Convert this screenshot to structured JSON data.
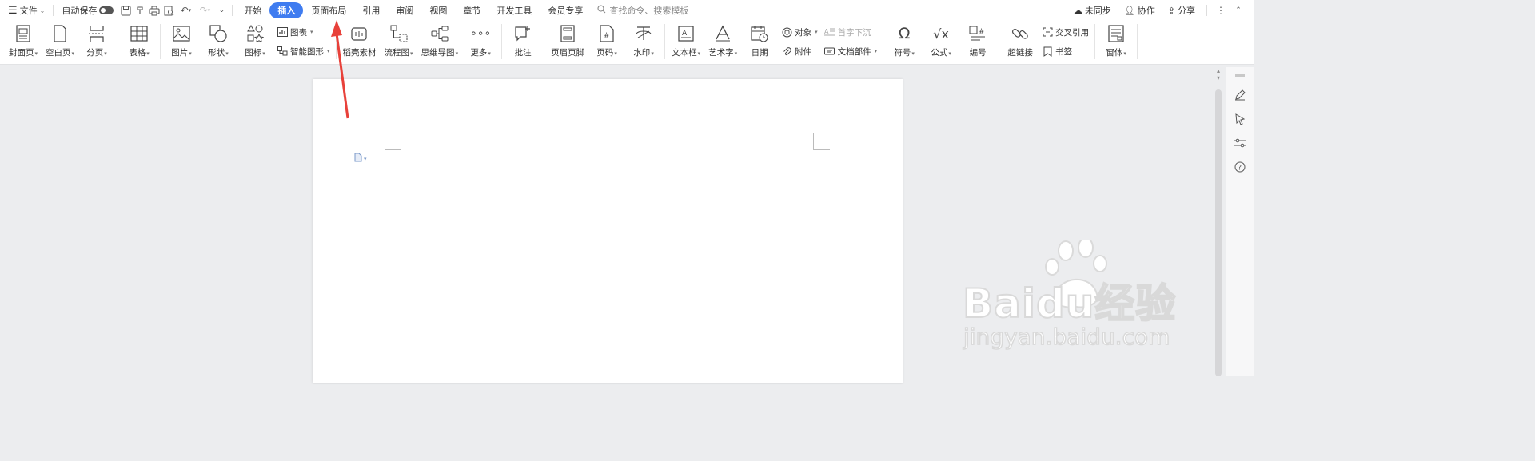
{
  "menubar": {
    "file_label": "文件",
    "autosave_label": "自动保存",
    "tabs": [
      {
        "label": "开始",
        "active": false
      },
      {
        "label": "插入",
        "active": true
      },
      {
        "label": "页面布局",
        "active": false
      },
      {
        "label": "引用",
        "active": false
      },
      {
        "label": "审阅",
        "active": false
      },
      {
        "label": "视图",
        "active": false
      },
      {
        "label": "章节",
        "active": false
      },
      {
        "label": "开发工具",
        "active": false
      },
      {
        "label": "会员专享",
        "active": false
      }
    ],
    "search_placeholder": "查找命令、搜索模板",
    "sync_label": "未同步",
    "collab_label": "协作",
    "share_label": "分享"
  },
  "ribbon": {
    "cover_page": "封面页",
    "blank_page": "空白页",
    "page_break": "分页",
    "table": "表格",
    "picture": "图片",
    "shape": "形状",
    "icon": "图标",
    "chart": "图表",
    "smart_art": "智能图形",
    "doc_material": "稻壳素材",
    "flowchart": "流程图",
    "mind_map": "思维导图",
    "more": "更多",
    "comment": "批注",
    "header_footer": "页眉页脚",
    "page_number": "页码",
    "watermark": "水印",
    "text_box": "文本框",
    "word_art": "艺术字",
    "date": "日期",
    "object": "对象",
    "attachment": "附件",
    "drop_cap": "首字下沉",
    "doc_parts": "文档部件",
    "symbol": "符号",
    "formula": "公式",
    "numbering": "编号",
    "hyperlink": "超链接",
    "cross_ref": "交叉引用",
    "bookmark": "书签",
    "form": "窗体"
  },
  "watermark_logo": {
    "main": "Baidu经验",
    "sub": "jingyan.baidu.com"
  },
  "colors": {
    "accent": "#3f7cf0",
    "arrow": "#e8413a",
    "page_bg": "#ecedef"
  }
}
